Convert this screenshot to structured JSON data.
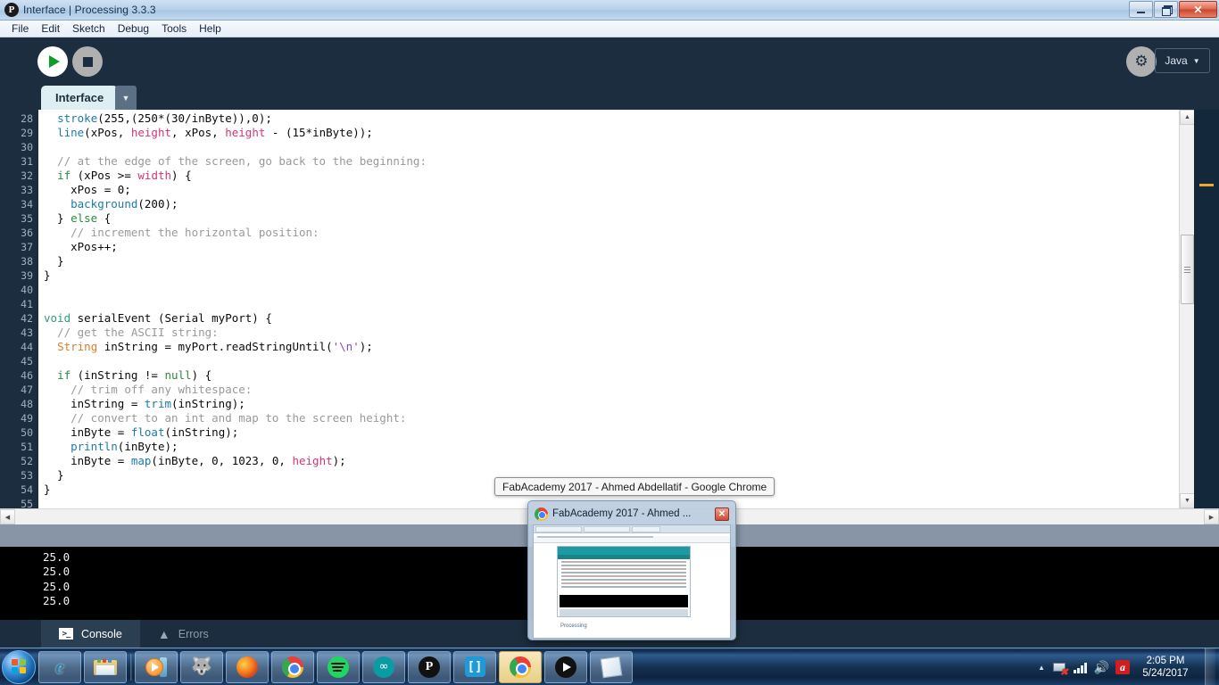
{
  "window": {
    "title": "Interface | Processing 3.3.3",
    "icon": "processing-logo-icon",
    "controls": {
      "minimize": "minimize",
      "restore": "restore",
      "close": "✕"
    }
  },
  "menubar": {
    "items": [
      "File",
      "Edit",
      "Sketch",
      "Debug",
      "Tools",
      "Help"
    ]
  },
  "toolbar": {
    "run_label": "Run",
    "stop_label": "Stop",
    "debug_label": "Debugger",
    "mode_label": "Java",
    "mode_caret": "▼"
  },
  "tabs": {
    "sketch_tab": "Interface",
    "tab_menu_caret": "▼"
  },
  "editor": {
    "first_line_number": 28,
    "lines": [
      {
        "n": 28,
        "tokens": [
          {
            "t": "  ",
            "c": ""
          },
          {
            "t": "stroke",
            "c": "tk-fn"
          },
          {
            "t": "(255,(250*(30/inByte)),0);",
            "c": ""
          }
        ]
      },
      {
        "n": 29,
        "tokens": [
          {
            "t": "  ",
            "c": ""
          },
          {
            "t": "line",
            "c": "tk-fn"
          },
          {
            "t": "(xPos, ",
            "c": ""
          },
          {
            "t": "height",
            "c": "tk-const"
          },
          {
            "t": ", xPos, ",
            "c": ""
          },
          {
            "t": "height",
            "c": "tk-const"
          },
          {
            "t": " - (15*inByte));",
            "c": ""
          }
        ]
      },
      {
        "n": 30,
        "tokens": [
          {
            "t": "",
            "c": ""
          }
        ]
      },
      {
        "n": 31,
        "tokens": [
          {
            "t": "  ",
            "c": ""
          },
          {
            "t": "// at the edge of the screen, go back to the beginning:",
            "c": "tk-cmt"
          }
        ]
      },
      {
        "n": 32,
        "tokens": [
          {
            "t": "  ",
            "c": ""
          },
          {
            "t": "if",
            "c": "tk-kw"
          },
          {
            "t": " (xPos >= ",
            "c": ""
          },
          {
            "t": "width",
            "c": "tk-const"
          },
          {
            "t": ") {",
            "c": ""
          }
        ]
      },
      {
        "n": 33,
        "tokens": [
          {
            "t": "    xPos = 0;",
            "c": ""
          }
        ]
      },
      {
        "n": 34,
        "tokens": [
          {
            "t": "    ",
            "c": ""
          },
          {
            "t": "background",
            "c": "tk-fn"
          },
          {
            "t": "(200);",
            "c": ""
          }
        ]
      },
      {
        "n": 35,
        "tokens": [
          {
            "t": "  } ",
            "c": ""
          },
          {
            "t": "else",
            "c": "tk-kw"
          },
          {
            "t": " {",
            "c": ""
          }
        ]
      },
      {
        "n": 36,
        "tokens": [
          {
            "t": "    ",
            "c": ""
          },
          {
            "t": "// increment the horizontal position:",
            "c": "tk-cmt"
          }
        ]
      },
      {
        "n": 37,
        "tokens": [
          {
            "t": "    xPos++;",
            "c": ""
          }
        ]
      },
      {
        "n": 38,
        "tokens": [
          {
            "t": "  }",
            "c": ""
          }
        ]
      },
      {
        "n": 39,
        "tokens": [
          {
            "t": "}",
            "c": ""
          }
        ]
      },
      {
        "n": 40,
        "tokens": [
          {
            "t": "",
            "c": ""
          }
        ]
      },
      {
        "n": 41,
        "tokens": [
          {
            "t": "",
            "c": ""
          }
        ]
      },
      {
        "n": 42,
        "tokens": [
          {
            "t": "void",
            "c": "tk-kw2"
          },
          {
            "t": " serialEvent (Serial myPort) {",
            "c": ""
          }
        ]
      },
      {
        "n": 43,
        "tokens": [
          {
            "t": "  ",
            "c": ""
          },
          {
            "t": "// get the ASCII string:",
            "c": "tk-cmt"
          }
        ]
      },
      {
        "n": 44,
        "tokens": [
          {
            "t": "  ",
            "c": ""
          },
          {
            "t": "String",
            "c": "tk-type"
          },
          {
            "t": " inString = myPort.readStringUntil(",
            "c": ""
          },
          {
            "t": "'\\n'",
            "c": "tk-str"
          },
          {
            "t": ");",
            "c": ""
          }
        ]
      },
      {
        "n": 45,
        "tokens": [
          {
            "t": "",
            "c": ""
          }
        ]
      },
      {
        "n": 46,
        "tokens": [
          {
            "t": "  ",
            "c": ""
          },
          {
            "t": "if",
            "c": "tk-kw"
          },
          {
            "t": " (inString != ",
            "c": ""
          },
          {
            "t": "null",
            "c": "tk-kw"
          },
          {
            "t": ") {",
            "c": ""
          }
        ]
      },
      {
        "n": 47,
        "tokens": [
          {
            "t": "    ",
            "c": ""
          },
          {
            "t": "// trim off any whitespace:",
            "c": "tk-cmt"
          }
        ]
      },
      {
        "n": 48,
        "tokens": [
          {
            "t": "    inString = ",
            "c": ""
          },
          {
            "t": "trim",
            "c": "tk-fn"
          },
          {
            "t": "(inString);",
            "c": ""
          }
        ]
      },
      {
        "n": 49,
        "tokens": [
          {
            "t": "    ",
            "c": ""
          },
          {
            "t": "// convert to an int and map to the screen height:",
            "c": "tk-cmt"
          }
        ]
      },
      {
        "n": 50,
        "tokens": [
          {
            "t": "    inByte = ",
            "c": ""
          },
          {
            "t": "float",
            "c": "tk-fn"
          },
          {
            "t": "(inString);",
            "c": ""
          }
        ]
      },
      {
        "n": 51,
        "tokens": [
          {
            "t": "    ",
            "c": ""
          },
          {
            "t": "println",
            "c": "tk-fn"
          },
          {
            "t": "(inByte);",
            "c": ""
          }
        ]
      },
      {
        "n": 52,
        "tokens": [
          {
            "t": "    inByte = ",
            "c": ""
          },
          {
            "t": "map",
            "c": "tk-fn"
          },
          {
            "t": "(inByte, 0, 1023, 0, ",
            "c": ""
          },
          {
            "t": "height",
            "c": "tk-const"
          },
          {
            "t": ");",
            "c": ""
          }
        ]
      },
      {
        "n": 53,
        "tokens": [
          {
            "t": "  }",
            "c": ""
          }
        ]
      },
      {
        "n": 54,
        "tokens": [
          {
            "t": "}",
            "c": ""
          }
        ]
      },
      {
        "n": 55,
        "tokens": [
          {
            "t": "",
            "c": ""
          }
        ]
      }
    ],
    "marker_color": "#f0a828"
  },
  "console": {
    "lines": [
      "25.0",
      "25.0",
      "25.0",
      "25.0"
    ]
  },
  "bottom_tabs": {
    "console_label": "Console",
    "errors_label": "Errors",
    "active": "Console"
  },
  "thumbnail_preview": {
    "tooltip": "FabAcademy 2017 - Ahmed Abdellatif - Google Chrome",
    "window_title": "FabAcademy 2017 - Ahmed ...",
    "close_glyph": "✕",
    "page_label": "Processing"
  },
  "taskbar": {
    "start_label": "Start",
    "items": [
      {
        "name": "internet-explorer",
        "label": "Internet Explorer",
        "active": false
      },
      {
        "name": "file-explorer",
        "label": "Windows Explorer",
        "active": false
      },
      {
        "name": "windows-media-player",
        "label": "Windows Media Player",
        "active": false
      },
      {
        "name": "gimp",
        "label": "GIMP",
        "active": false
      },
      {
        "name": "firefox",
        "label": "Mozilla Firefox",
        "active": false
      },
      {
        "name": "chrome",
        "label": "Google Chrome",
        "active": false
      },
      {
        "name": "spotify",
        "label": "Spotify",
        "active": false
      },
      {
        "name": "arduino",
        "label": "Arduino IDE",
        "active": false
      },
      {
        "name": "processing",
        "label": "Processing",
        "active": false
      },
      {
        "name": "brackets",
        "label": "Brackets",
        "active": false
      },
      {
        "name": "chrome-window",
        "label": "Google Chrome",
        "active": true
      },
      {
        "name": "processing-sketch",
        "label": "Processing Sketch",
        "active": false
      },
      {
        "name": "notepad",
        "label": "Notepad",
        "active": false
      }
    ],
    "tray": {
      "overflow_glyph": "▲",
      "network_label": "Network (not connected)",
      "signal_label": "Signal strength",
      "volume_glyph": "🔊",
      "antivirus_label": "Avira",
      "time": "2:05 PM",
      "date": "5/24/2017"
    }
  },
  "icons": {
    "gimp_glyph": "🐺",
    "arduino_glyph": "∞",
    "processing_glyph": "P",
    "brackets_glyph": "[]"
  }
}
